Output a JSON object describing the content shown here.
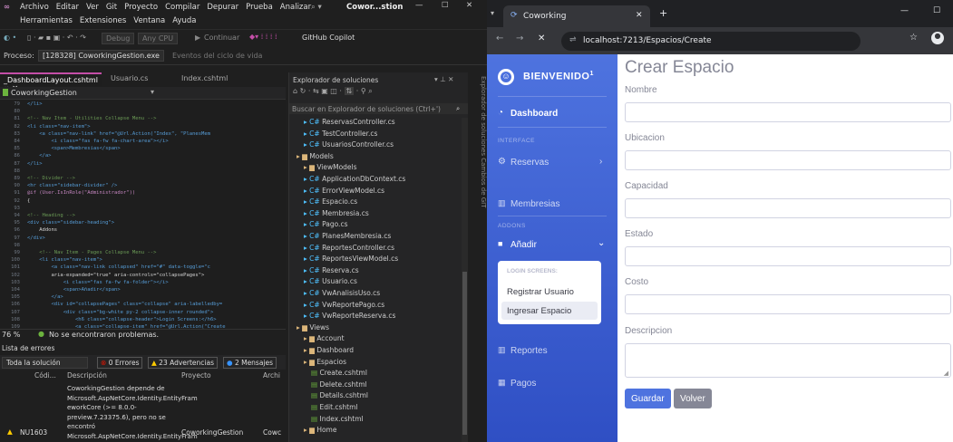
{
  "vs": {
    "menu": [
      "Archivo",
      "Editar",
      "Ver",
      "Git",
      "Proyecto",
      "Compilar",
      "Depurar",
      "Prueba",
      "Analizar"
    ],
    "menu2": [
      "Herramientas",
      "Extensiones",
      "Ventana",
      "Ayuda"
    ],
    "search": "Cowor...stion",
    "debug_label": "Debug",
    "cpu_label": "Any CPU",
    "continue_label": "Continuar",
    "copilot_label": "GitHub Copilot",
    "process_label": "Proceso:",
    "process_value": "[128328] CoworkingGestion.exe",
    "lifecycle_label": "Eventos del ciclo de vida",
    "tabs": [
      "_DashboardLayout.cshtml",
      "Usuario.cs",
      "Index.cshtml"
    ],
    "breadcrumb": "CoworkingGestion",
    "zoom": "76 %",
    "no_problems": "No se encontraron problemas.",
    "code_lines": [
      {
        "n": "79",
        "t": "</li>"
      },
      {
        "n": "80",
        "t": ""
      },
      {
        "n": "81",
        "t": "<!-- Nav Item - Utilities Collapse Menu -->"
      },
      {
        "n": "82",
        "t": "<li class=\"nav-item\">"
      },
      {
        "n": "83",
        "t": "    <a class=\"nav-link\" href=\"@Url.Action(\"Index\", \"PlanesMem"
      },
      {
        "n": "84",
        "t": "        <i class=\"fas fa-fw fa-chart-area\"></i>"
      },
      {
        "n": "85",
        "t": "        <span>Membresias</span>"
      },
      {
        "n": "86",
        "t": "    </a>"
      },
      {
        "n": "87",
        "t": "</li>"
      },
      {
        "n": "88",
        "t": ""
      },
      {
        "n": "89",
        "t": "<!-- Divider -->"
      },
      {
        "n": "90",
        "t": "<hr class=\"sidebar-divider\" />"
      },
      {
        "n": "91",
        "t": "@if (User.IsInRole(\"Administrador\"))"
      },
      {
        "n": "92",
        "t": "{"
      },
      {
        "n": "93",
        "t": ""
      },
      {
        "n": "94",
        "t": "<!-- Heading -->"
      },
      {
        "n": "95",
        "t": "<div class=\"sidebar-heading\">"
      },
      {
        "n": "96",
        "t": "    Addons"
      },
      {
        "n": "97",
        "t": "</div>"
      },
      {
        "n": "98",
        "t": ""
      },
      {
        "n": "99",
        "t": "    <!-- Nav Item - Pages Collapse Menu -->"
      },
      {
        "n": "100",
        "t": "    <li class=\"nav-item\">"
      },
      {
        "n": "101",
        "t": "        <a class=\"nav-link collapsed\" href=\"#\" data-toggle=\"c"
      },
      {
        "n": "102",
        "t": "        aria-expanded=\"true\" aria-controls=\"collapsePages\">"
      },
      {
        "n": "103",
        "t": "            <i class=\"fas fa-fw fa-folder\"></i>"
      },
      {
        "n": "104",
        "t": "            <span>Añadir</span>"
      },
      {
        "n": "105",
        "t": "        </a>"
      },
      {
        "n": "106",
        "t": "        <div id=\"collapsePages\" class=\"collapse\" aria-labelledby="
      },
      {
        "n": "107",
        "t": "            <div class=\"bg-white py-2 collapse-inner rounded\">"
      },
      {
        "n": "108",
        "t": "                <h6 class=\"collapse-header\">Login Screens:</h6>"
      },
      {
        "n": "109",
        "t": "                <a class=\"collapse-item\" href=\"@Url.Action(\"Create"
      }
    ],
    "errors": {
      "title": "Lista de errores",
      "scope": "Toda la solución",
      "errors_count": "0 Errores",
      "warnings_count": "23 Advertencias",
      "messages_count": "2 Mensajes",
      "col_code": "Códi...",
      "col_desc": "Descripción",
      "col_project": "Proyecto",
      "col_file": "Archi",
      "row1_desc": "CoworkingGestion depende de Microsoft.AspNetCore.Identity.EntityFram eworkCore (>= 8.0.0-preview.7.23375.6), pero no se encontró Microsoft.AspNetCore.Identity.EntityFram eworkCore 8.0.0-preview.7.23375.6. Se",
      "row1_code": "NU1603",
      "row1_project": "CoworkingGestion",
      "row1_file": "Cowc"
    },
    "explorer": {
      "title": "Explorador de soluciones",
      "search_placeholder": "Buscar en Explorador de soluciones (Ctrl+')",
      "items": [
        {
          "label": "ReservasController.cs",
          "type": "cs",
          "indent": 1
        },
        {
          "label": "TestController.cs",
          "type": "cs",
          "indent": 1
        },
        {
          "label": "UsuariosController.cs",
          "type": "cs",
          "indent": 1
        },
        {
          "label": "Models",
          "type": "folder",
          "indent": 0
        },
        {
          "label": "ViewModels",
          "type": "folder",
          "indent": 1
        },
        {
          "label": "ApplicationDbContext.cs",
          "type": "cs",
          "indent": 1
        },
        {
          "label": "ErrorViewModel.cs",
          "type": "cs",
          "indent": 1
        },
        {
          "label": "Espacio.cs",
          "type": "cs",
          "indent": 1
        },
        {
          "label": "Membresia.cs",
          "type": "cs",
          "indent": 1
        },
        {
          "label": "Pago.cs",
          "type": "cs",
          "indent": 1
        },
        {
          "label": "PlanesMembresia.cs",
          "type": "cs",
          "indent": 1
        },
        {
          "label": "ReportesController.cs",
          "type": "cs",
          "indent": 1
        },
        {
          "label": "ReportesViewModel.cs",
          "type": "cs",
          "indent": 1
        },
        {
          "label": "Reserva.cs",
          "type": "cs",
          "indent": 1
        },
        {
          "label": "Usuario.cs",
          "type": "cs",
          "indent": 1
        },
        {
          "label": "VwAnalisisUso.cs",
          "type": "cs",
          "indent": 1
        },
        {
          "label": "VwReportePago.cs",
          "type": "cs",
          "indent": 1
        },
        {
          "label": "VwReporteReserva.cs",
          "type": "cs",
          "indent": 1
        },
        {
          "label": "Views",
          "type": "folder",
          "indent": 0
        },
        {
          "label": "Account",
          "type": "folder",
          "indent": 1
        },
        {
          "label": "Dashboard",
          "type": "folder",
          "indent": 1
        },
        {
          "label": "Espacios",
          "type": "folder",
          "indent": 1
        },
        {
          "label": "Create.cshtml",
          "type": "file",
          "indent": 2
        },
        {
          "label": "Delete.cshtml",
          "type": "file",
          "indent": 2
        },
        {
          "label": "Details.cshtml",
          "type": "file",
          "indent": 2
        },
        {
          "label": "Edit.cshtml",
          "type": "file",
          "indent": 2
        },
        {
          "label": "Index.cshtml",
          "type": "file",
          "indent": 2
        },
        {
          "label": "Home",
          "type": "folder",
          "indent": 1
        }
      ]
    },
    "vtabs": "Explorador de soluciones   Cambios de GIT"
  },
  "browser": {
    "tab_title": "Coworking",
    "url": "localhost:7213/Espacios/Create"
  },
  "app": {
    "brand": "BIENVENIDO",
    "brand_sup": "1",
    "dashboard": "Dashboard",
    "interface_heading": "INTERFACE",
    "reservas": "Reservas",
    "membresias": "Membresias",
    "addons_heading": "ADDONS",
    "anadir": "Añadir",
    "login_screens": "LOGIN SCREENS:",
    "registrar": "Registrar Usuario",
    "ingresar": "Ingresar Espacio",
    "reportes": "Reportes",
    "pagos": "Pagos",
    "page_title": "Crear Espacio",
    "fields": [
      "Nombre",
      "Ubicacion",
      "Capacidad",
      "Estado",
      "Costo",
      "Descripcion"
    ],
    "save_label": "Guardar",
    "back_label": "Volver",
    "accent": "#4e73df"
  }
}
